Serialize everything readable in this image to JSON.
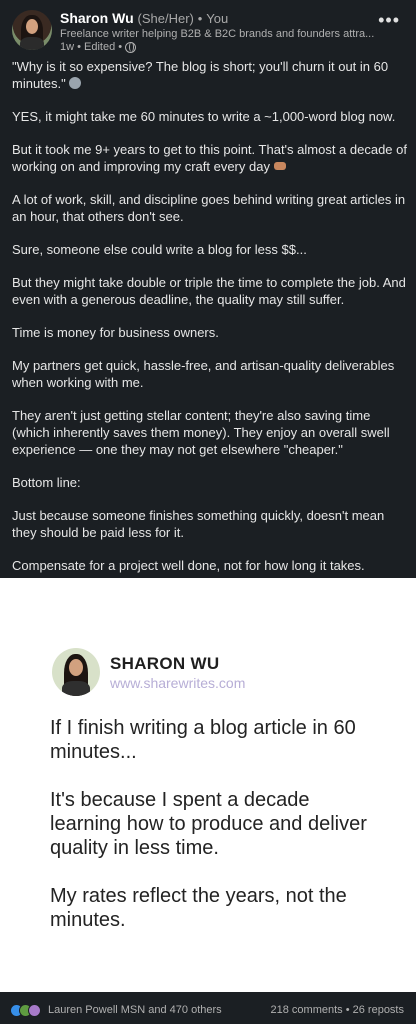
{
  "post": {
    "author_name": "Sharon Wu",
    "pronouns": "(She/Her)",
    "separator": "•",
    "relationship": "You",
    "headline": "Freelance writer helping B2B & B2C brands and founders attra...",
    "meta": "1w • Edited •",
    "more_icon": "more-horizontal-icon",
    "paragraphs": [
      "\"Why is it so expensive? The blog is short; you'll churn it out in 60 minutes.\"",
      "YES, it might take me 60 minutes to write a ~1,000-word blog now.",
      "But it took me 9+ years to get to this point. That's almost a decade of working on and improving my craft every day",
      "A lot of work, skill, and discipline goes behind writing great articles in an hour, that others don't see.",
      "Sure, someone else could write a blog for less $$...",
      "But they might take double or triple the time to complete the job. And even with a generous deadline, the quality may still suffer.",
      "Time is money for business owners.",
      "My partners get quick, hassle-free, and artisan-quality deliverables when working with me.",
      "They aren't just getting stellar content; they're also saving time (which inherently saves them money). They enjoy an overall swell experience — one they may not get elsewhere \"cheaper.\"",
      "Bottom line:",
      "Just because someone finishes something quickly, doesn't mean they should be paid less for it.",
      "Compensate for a project well done, not for how long it takes."
    ]
  },
  "image": {
    "brand_name": "SHARON WU",
    "brand_url": "www.sharewrites.com",
    "quote_lines": [
      "If I finish writing a blog article in 60 minutes...",
      "It's because I spent a decade learning how to produce and deliver quality in less time.",
      "My rates reflect the years, not the minutes."
    ]
  },
  "footer": {
    "reactors": "Lauren Powell MSN and 470 others",
    "stats": "218 comments • 26 reposts",
    "reaction_icons": [
      "like-icon",
      "celebrate-icon",
      "support-icon"
    ]
  }
}
